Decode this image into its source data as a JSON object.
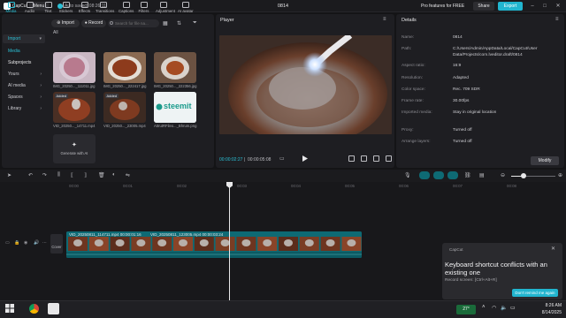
{
  "app": {
    "name": "CapCut",
    "menu_label": "Menu",
    "autosave": "Auto saved: 08:26:11",
    "project_title": "0814",
    "pro_label": "Pro features for FREE",
    "share_label": "Share",
    "export_label": "Export"
  },
  "window_controls": [
    "–",
    "□",
    "✕"
  ],
  "media_tabs": [
    "Media",
    "Audio",
    "Text",
    "Stickers",
    "Effects",
    "Transitions",
    "Captions",
    "Filters",
    "Adjustment",
    "AI avatar"
  ],
  "left_nav": {
    "import": "Import",
    "media": "Media",
    "subprojects": "Subprojects",
    "yours": "Yours",
    "ai_media": "AI media",
    "spaces": "Spaces",
    "library": "Library"
  },
  "media_toolbar": {
    "import_label": "Import",
    "record_label": "Record",
    "search_placeholder": "Search for file na..."
  },
  "all_label": "All",
  "media_items": [
    {
      "caption": "IMG_20250..._111011.jpg",
      "badge": ""
    },
    {
      "caption": "IMG_20250..._222417.jpg",
      "badge": ""
    },
    {
      "caption": "IMG_20250..._222356.jpg",
      "badge": ""
    },
    {
      "caption": "VID_20250..._14711.mp4",
      "badge": "Added"
    },
    {
      "caption": "VID_20250..._23005.mp4",
      "badge": "Added"
    },
    {
      "caption": "AttrutRFileo..._Bhrum.png",
      "badge": ""
    }
  ],
  "steemit_text": "steemit",
  "ai_card_label": "Generate with AI",
  "player": {
    "title": "Player",
    "time_current": "00:00:02:27",
    "time_total": "00:00:05:08"
  },
  "details": {
    "title": "Details",
    "rows": [
      {
        "label": "Name:",
        "value": "0814"
      },
      {
        "label": "Path:",
        "value": "C:/Users/Admin/AppData/Local/CapCut/User Data/Projects/com.lveditor.draft/0814"
      },
      {
        "label": "Aspect ratio:",
        "value": "16:9"
      },
      {
        "label": "Resolution:",
        "value": "Adapted"
      },
      {
        "label": "Color space:",
        "value": "Rec. 709 SDR"
      },
      {
        "label": "Frame rate:",
        "value": "30.00fps"
      },
      {
        "label": "Imported media:",
        "value": "Stay in original location"
      },
      {
        "label": "Proxy:",
        "value": "Turned off"
      },
      {
        "label": "Arrange layers:",
        "value": "Turned off"
      }
    ],
    "modify_label": "Modify"
  },
  "timeline": {
    "ticks": [
      "00:00",
      "00:01",
      "00:02",
      "00:03",
      "00:04",
      "00:05",
      "00:06",
      "00:07",
      "00:08"
    ],
    "clip1_label": "VID_20250811_114711.mp4   00:00:01:16",
    "clip2_label": "VID_20250811_123005.mp4   00:00:03:24",
    "cover_label": "Cover"
  },
  "notification": {
    "app": "CapCut",
    "title": "Keyboard shortcut conflicts with an existing one",
    "body": "Record screen: [Ctrl+Alt+R]",
    "button": "Don't remind me again"
  },
  "taskbar": {
    "weather": "27°",
    "time": "8:26 AM",
    "date": "8/14/2025"
  },
  "colors": {
    "accent": "#21b5cf",
    "clip": "#0e6a74",
    "panel": "#1e1e22"
  }
}
